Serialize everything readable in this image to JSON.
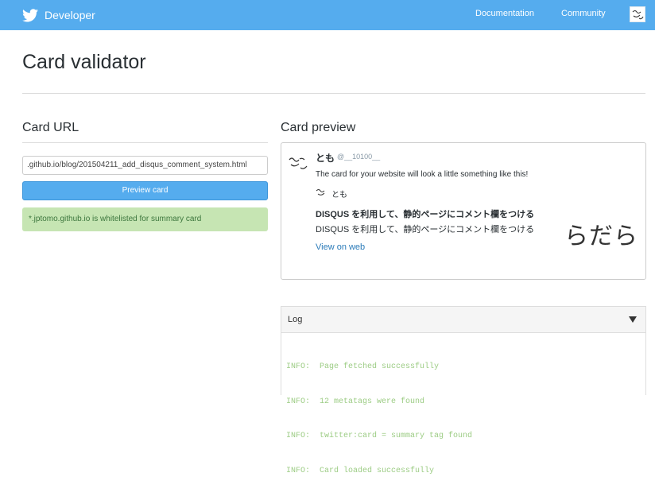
{
  "header": {
    "brand": "Developer",
    "nav": {
      "documentation": "Documentation",
      "community": "Community"
    }
  },
  "page": {
    "title": "Card validator"
  },
  "card_url": {
    "section_title": "Card URL",
    "input_value": ".github.io/blog/201504211_add_disqus_comment_system.html",
    "preview_button": "Preview card",
    "alert": "*.jptomo.github.io is whitelisted for summary card"
  },
  "card_preview": {
    "section_title": "Card preview",
    "author_name": "とも",
    "author_handle": "@__10100__",
    "tweet_text": "The card for your website will look a little something like this!",
    "site_name": "とも",
    "card_title": "DISQUS を利用して、静的ページにコメント欄をつける",
    "card_description": "DISQUS を利用して、静的ページにコメント欄をつける",
    "link_text": "View on web",
    "thumbnail_text": "らだら"
  },
  "log": {
    "title": "Log",
    "lines": [
      "INFO:  Page fetched successfully",
      "INFO:  12 metatags were found",
      "INFO:  twitter:card = summary tag found",
      "INFO:  Card loaded successfully"
    ]
  },
  "colors": {
    "brand_blue": "#55acee",
    "success_bg": "#c6e5b3",
    "log_text": "#9ccc84",
    "link": "#2b7bb9"
  },
  "icons": {
    "brand": "twitter-bird-icon",
    "log_toggle": "caret-down-icon"
  }
}
